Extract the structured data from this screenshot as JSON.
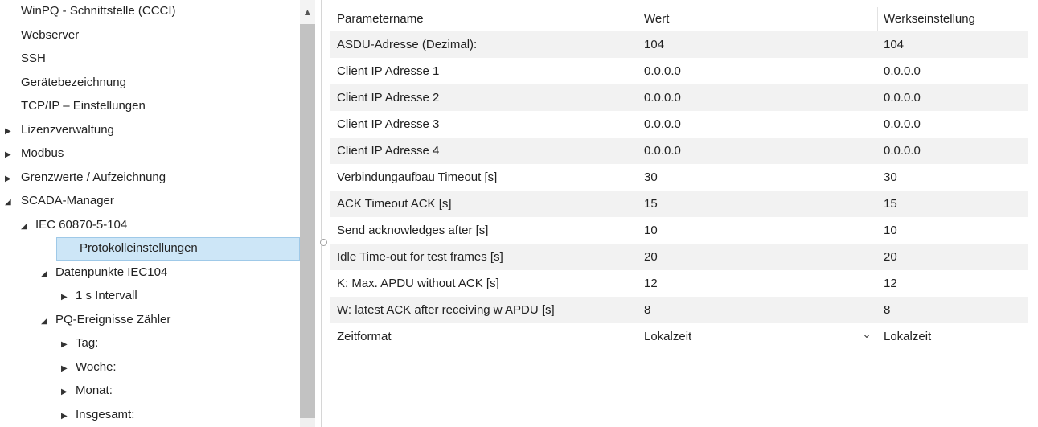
{
  "tree": {
    "items": [
      {
        "label": "WinPQ - Schnittstelle (CCCI)",
        "level": 0,
        "arrow": ""
      },
      {
        "label": "Webserver",
        "level": 0,
        "arrow": ""
      },
      {
        "label": "SSH",
        "level": 0,
        "arrow": ""
      },
      {
        "label": "Gerätebezeichnung",
        "level": 0,
        "arrow": ""
      },
      {
        "label": "TCP/IP – Einstellungen",
        "level": 0,
        "arrow": ""
      },
      {
        "label": "Lizenzverwaltung",
        "level": 0,
        "arrow": "▶"
      },
      {
        "label": "Modbus",
        "level": 0,
        "arrow": "▶"
      },
      {
        "label": "Grenzwerte / Aufzeichnung",
        "level": 0,
        "arrow": "▶"
      },
      {
        "label": "SCADA-Manager",
        "level": 0,
        "arrow": "◢"
      },
      {
        "label": "IEC 60870-5-104",
        "level": 1,
        "arrow": "◢"
      },
      {
        "label": "Protokolleinstellungen",
        "level": 2,
        "arrow": "",
        "selected": true
      },
      {
        "label": "Datenpunkte IEC104",
        "level": 2,
        "arrow": "◢"
      },
      {
        "label": "1 s Intervall",
        "level": 3,
        "arrow": "▶"
      },
      {
        "label": "PQ-Ereignisse Zähler",
        "level": 2,
        "arrow": "◢"
      },
      {
        "label": "Tag:",
        "level": 3,
        "arrow": "▶"
      },
      {
        "label": "Woche:",
        "level": 3,
        "arrow": "▶"
      },
      {
        "label": "Monat:",
        "level": 3,
        "arrow": "▶"
      },
      {
        "label": "Insgesamt:",
        "level": 3,
        "arrow": "▶"
      }
    ],
    "scroll_up_icon": "▲"
  },
  "grid": {
    "headers": {
      "name": "Parametername",
      "value": "Wert",
      "default": "Werkseinstellung"
    },
    "rows": [
      {
        "name": "ASDU-Adresse (Dezimal):",
        "value": "104",
        "default": "104"
      },
      {
        "name": "Client IP Adresse 1",
        "value": "0.0.0.0",
        "default": "0.0.0.0"
      },
      {
        "name": "Client IP Adresse 2",
        "value": "0.0.0.0",
        "default": "0.0.0.0"
      },
      {
        "name": "Client IP Adresse 3",
        "value": "0.0.0.0",
        "default": "0.0.0.0"
      },
      {
        "name": "Client IP Adresse 4",
        "value": "0.0.0.0",
        "default": "0.0.0.0"
      },
      {
        "name": "Verbindungaufbau Timeout [s]",
        "value": "30",
        "default": "30"
      },
      {
        "name": "ACK Timeout ACK [s]",
        "value": "15",
        "default": "15"
      },
      {
        "name": "Send acknowledges after [s]",
        "value": "10",
        "default": "10"
      },
      {
        "name": "Idle Time-out for test frames [s]",
        "value": "20",
        "default": "20"
      },
      {
        "name": "K: Max. APDU without ACK [s]",
        "value": "12",
        "default": "12"
      },
      {
        "name": "W: latest ACK after receiving w APDU [s]",
        "value": "8",
        "default": "8"
      },
      {
        "name": "Zeitformat",
        "value": "Lokalzeit",
        "default": "Lokalzeit",
        "dropdown": true
      }
    ],
    "dropdown_icon": "⌄"
  }
}
